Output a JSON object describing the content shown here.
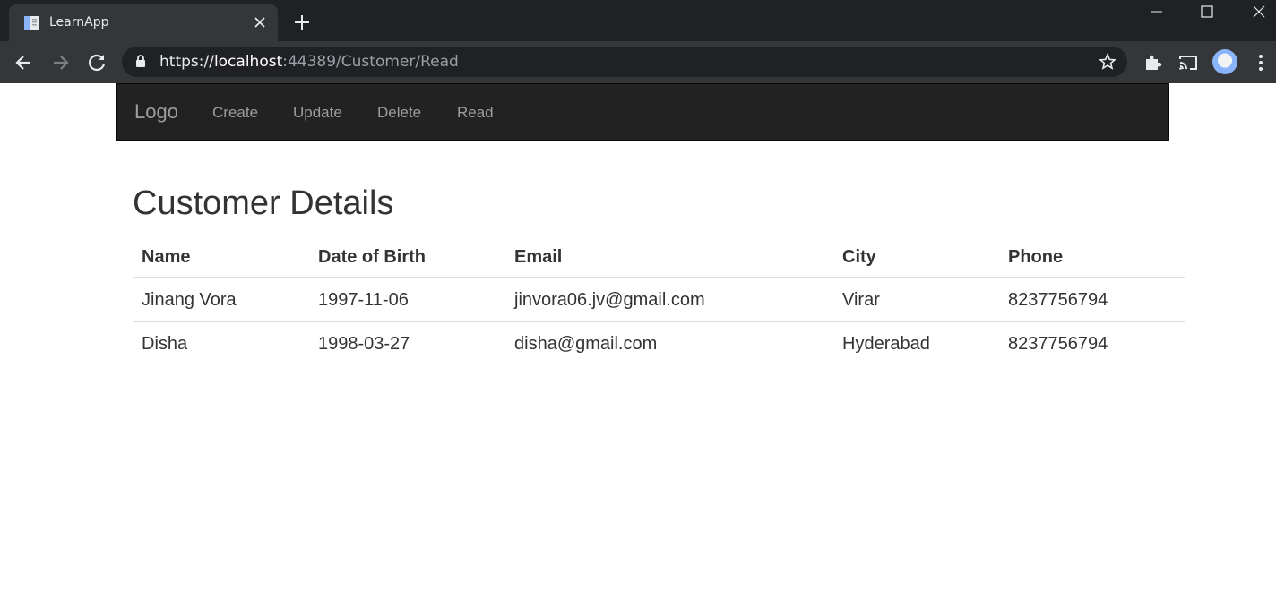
{
  "browser": {
    "tab_title": "LearnApp",
    "url_scheme": "https://",
    "url_host": "localhost",
    "url_rest": ":44389/Customer/Read"
  },
  "navbar": {
    "brand": "Logo",
    "links": [
      "Create",
      "Update",
      "Delete",
      "Read"
    ]
  },
  "page": {
    "title": "Customer Details",
    "columns": [
      "Name",
      "Date of Birth",
      "Email",
      "City",
      "Phone"
    ],
    "rows": [
      [
        "Jinang Vora",
        "1997-11-06",
        "jinvora06.jv@gmail.com",
        "Virar",
        "8237756794"
      ],
      [
        "Disha",
        "1998-03-27",
        "disha@gmail.com",
        "Hyderabad",
        "8237756794"
      ]
    ]
  }
}
